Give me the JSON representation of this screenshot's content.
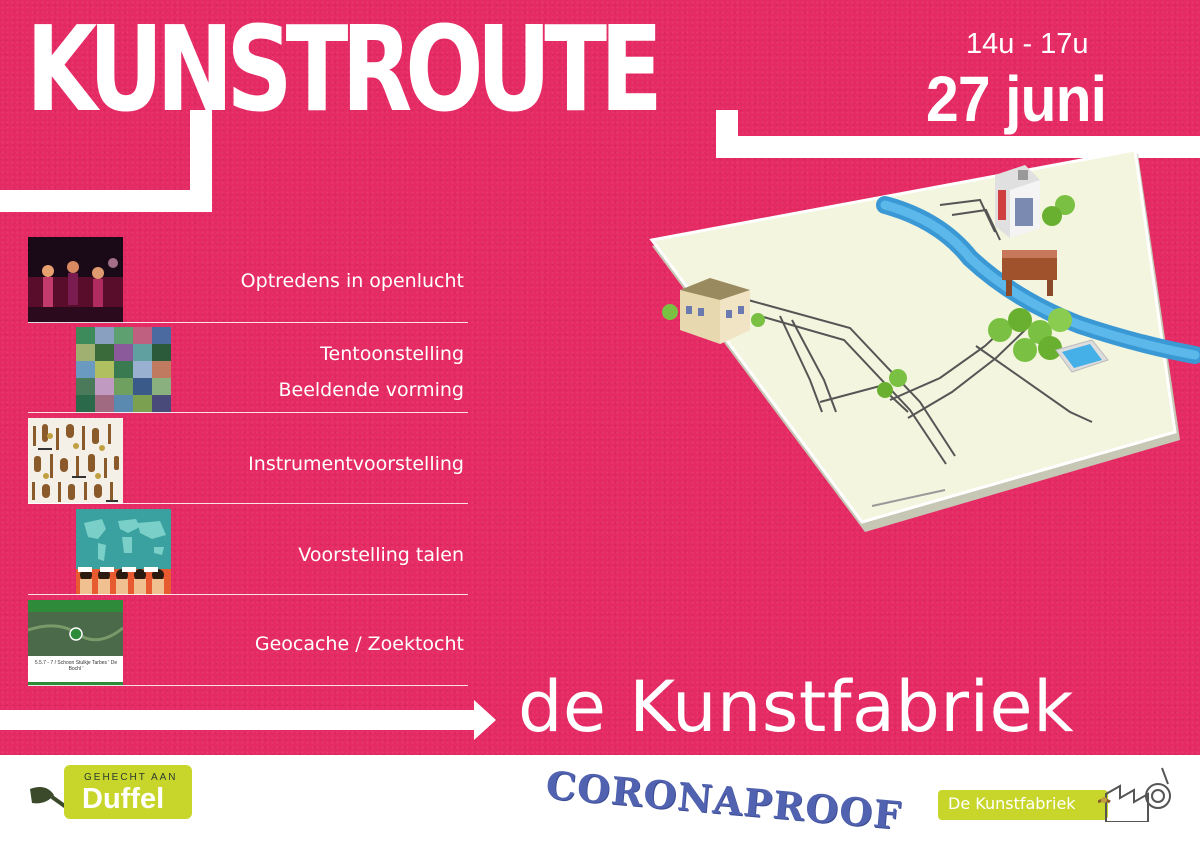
{
  "header": {
    "title": "KUNSTROUTE",
    "time": "14u - 17u",
    "date": "27 juni"
  },
  "activities": [
    {
      "label": "Optredens in openlucht",
      "thumb_icon": "concert-photo"
    },
    {
      "label": "Tentoonstelling",
      "label2": "Beeldende vorming",
      "thumb_icon": "artwork-collage"
    },
    {
      "label": "Instrumentvoorstelling",
      "thumb_icon": "instruments-collage"
    },
    {
      "label": "Voorstelling talen",
      "thumb_icon": "world-map-languages"
    },
    {
      "label": "Geocache / Zoektocht",
      "thumb_icon": "geocache-app-screenshot"
    }
  ],
  "geocache_thumb": {
    "caption": "5.5.7 - 7 / Schoon Stulkje Tarbes ' De Bochl '"
  },
  "brand": "de Kunstfabriek",
  "footer": {
    "duffel_small": "GEHECHT AAN",
    "duffel_big": "Duffel",
    "stamp": "CORONAPROOF",
    "kunstfabriek_logo": "De Kunstfabriek"
  },
  "colors": {
    "background": "#e52a64",
    "accent_green": "#c8d62b",
    "stamp_blue": "#3e52a8"
  }
}
